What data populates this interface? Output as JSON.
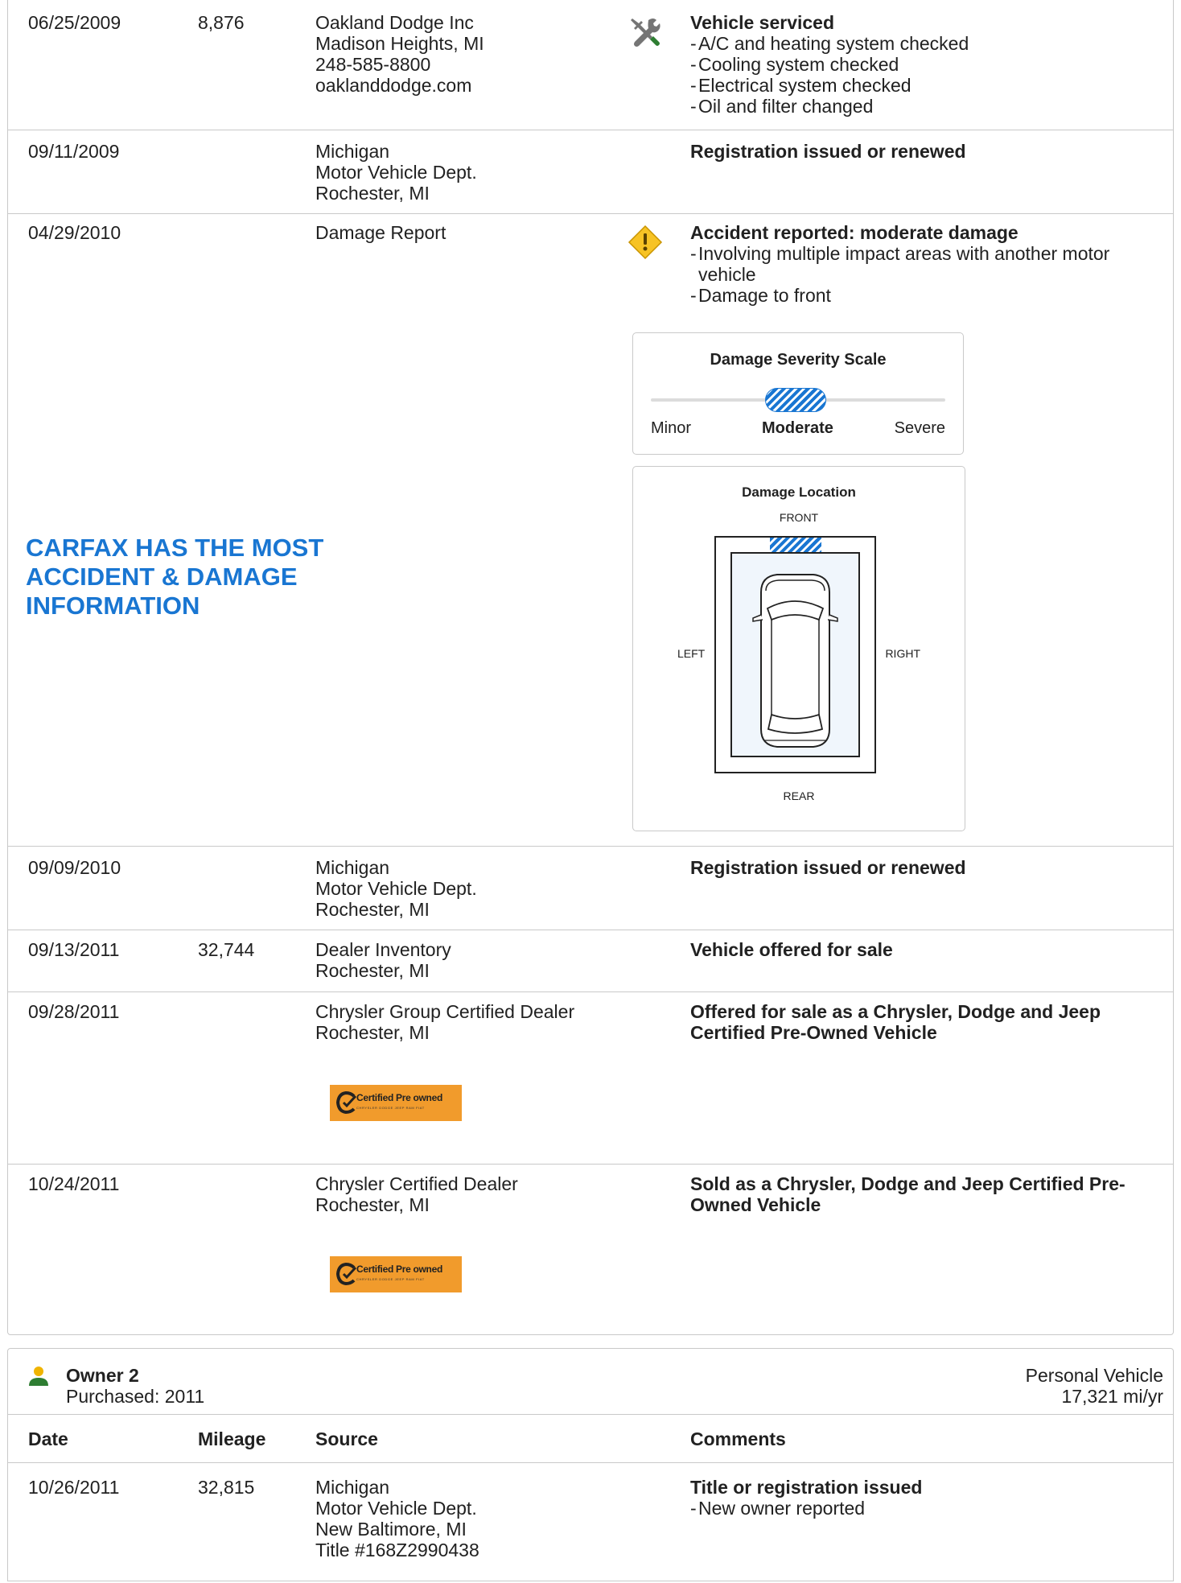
{
  "history": {
    "rows": [
      {
        "date": "06/25/2009",
        "mileage": "8,876",
        "source": [
          "Oakland Dodge Inc",
          "Madison Heights, MI",
          "248-585-8800",
          "oaklanddodge.com"
        ],
        "comment_title": "Vehicle serviced",
        "comment_items": [
          "A/C and heating system checked",
          "Cooling system checked",
          "Electrical system checked",
          "Oil and filter changed"
        ],
        "icon": "service-wrench-icon"
      },
      {
        "date": "09/11/2009",
        "mileage": "",
        "source": [
          "Michigan",
          "Motor Vehicle Dept.",
          "Rochester, MI"
        ],
        "comment_title": "Registration issued or renewed",
        "comment_items": []
      },
      {
        "date": "04/29/2010",
        "mileage": "",
        "source": [
          "Damage Report"
        ],
        "comment_title": "Accident reported: moderate damage",
        "comment_items": [
          "Involving multiple impact areas with another motor vehicle",
          "Damage to front"
        ],
        "icon": "warning-diamond-icon"
      },
      {
        "date": "09/09/2010",
        "mileage": "",
        "source": [
          "Michigan",
          "Motor Vehicle Dept.",
          "Rochester, MI"
        ],
        "comment_title": "Registration issued or renewed",
        "comment_items": []
      },
      {
        "date": "09/13/2011",
        "mileage": "32,744",
        "source": [
          "Dealer Inventory",
          "Rochester, MI"
        ],
        "comment_title": "Vehicle offered for sale",
        "comment_items": []
      },
      {
        "date": "09/28/2011",
        "mileage": "",
        "source": [
          "Chrysler Group Certified Dealer",
          "Rochester, MI"
        ],
        "comment_title": "Offered for sale as a Chrysler, Dodge and Jeep Certified Pre-Owned Vehicle",
        "comment_items": []
      },
      {
        "date": "10/24/2011",
        "mileage": "",
        "source": [
          "Chrysler Certified Dealer",
          "Rochester, MI"
        ],
        "comment_title": "Sold as a Chrysler, Dodge and Jeep Certified Pre-Owned Vehicle",
        "comment_items": []
      }
    ]
  },
  "promo": {
    "text": "CARFAX HAS THE MOST ACCIDENT & DAMAGE INFORMATION",
    "color": "#1976d2"
  },
  "damage_scale": {
    "title": "Damage Severity Scale",
    "labels": [
      "Minor",
      "Moderate",
      "Severe"
    ],
    "selected": "Moderate"
  },
  "damage_location": {
    "title": "Damage Location",
    "front": "FRONT",
    "rear": "REAR",
    "left": "LEFT",
    "right": "RIGHT",
    "damaged_area": "front"
  },
  "badge": {
    "text": "Certified Pre owned",
    "subtext": "CHRYSLER DODGE JEEP RAM FIAT",
    "color": "#f19b2c"
  },
  "owner2": {
    "title": "Owner 2",
    "purchased": "Purchased: 2011",
    "vehicle_type": "Personal Vehicle",
    "miles_per_year": "17,321 mi/yr",
    "icon": "person-icon",
    "columns": {
      "date": "Date",
      "mileage": "Mileage",
      "source": "Source",
      "comments": "Comments"
    },
    "rows": [
      {
        "date": "10/26/2011",
        "mileage": "32,815",
        "source": [
          "Michigan",
          "Motor Vehicle Dept.",
          "New Baltimore, MI",
          "Title #168Z2990438"
        ],
        "comment_title": "Title or registration issued",
        "comment_items": [
          "New owner reported"
        ]
      }
    ]
  }
}
